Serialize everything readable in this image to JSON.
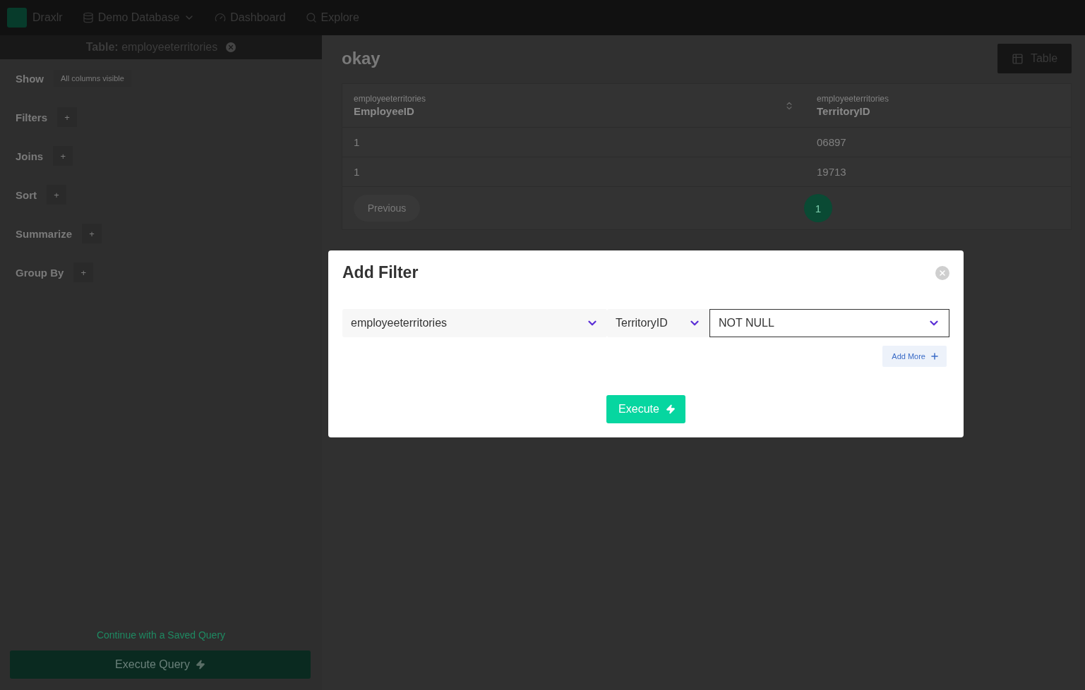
{
  "topbar": {
    "brand": "Draxlr",
    "nav": [
      {
        "label": "Demo Database",
        "dropdown": true
      },
      {
        "label": "Dashboard",
        "dropdown": false
      },
      {
        "label": "Explore",
        "dropdown": false
      }
    ]
  },
  "sidebar": {
    "table_prefix": "Table:",
    "table_name": "employeeterritories",
    "sections": [
      {
        "label": "Show",
        "kind": "note",
        "note": "All columns visible"
      },
      {
        "label": "Filters",
        "kind": "add",
        "add": "+"
      },
      {
        "label": "Joins",
        "kind": "add",
        "add": "+"
      },
      {
        "label": "Sort",
        "kind": "add",
        "add": "+"
      },
      {
        "label": "Summarize",
        "kind": "add",
        "add": "+"
      },
      {
        "label": "Group By",
        "kind": "add",
        "add": "+"
      }
    ],
    "saved_query_link": "Continue with a Saved Query",
    "execute_button": "Execute Query"
  },
  "main": {
    "title": "okay",
    "view_button": "Table",
    "table": {
      "columns": [
        {
          "table": "employeeterritories",
          "name": "EmployeeID",
          "sortable": true
        },
        {
          "table": "employeeterritories",
          "name": "TerritoryID",
          "sortable": false
        }
      ],
      "rows": [
        [
          "1",
          "06897"
        ],
        [
          "1",
          "19713"
        ]
      ]
    },
    "pagination": {
      "previous": "Previous",
      "pages": [
        {
          "label": "1",
          "selected": true
        }
      ]
    }
  },
  "modal": {
    "title": "Add Filter",
    "selects": [
      {
        "value": "employeeterritories",
        "kind": "filled"
      },
      {
        "value": "TerritoryID",
        "kind": "filled"
      },
      {
        "value": "NOT NULL",
        "kind": "outlined"
      }
    ],
    "add_more": "Add More",
    "execute": "Execute"
  }
}
